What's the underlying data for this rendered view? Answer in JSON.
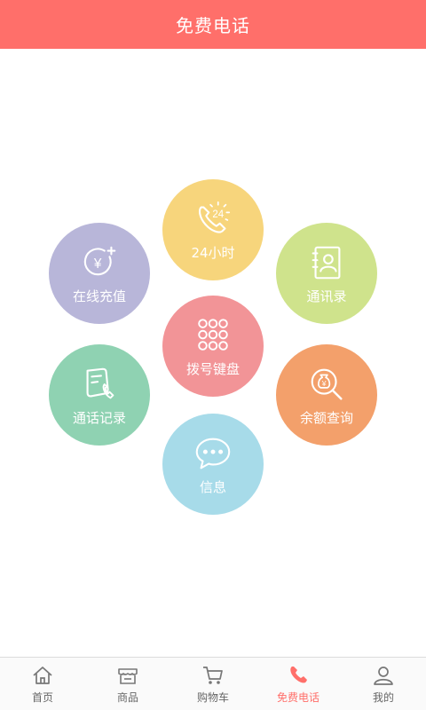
{
  "header": {
    "title": "免费电话"
  },
  "colors": {
    "header_bg": "#ff6f6a",
    "h24": "#f7d57c",
    "recharge": "#b8b6d9",
    "contacts": "#cfe38c",
    "dial": "#f29497",
    "record": "#8fd2b2",
    "balance": "#f3a06b",
    "message": "#a7dbe9",
    "tab_active": "#ff6f6a"
  },
  "features": {
    "h24": {
      "label": "24小时",
      "icon": "phone-24h-icon"
    },
    "recharge": {
      "label": "在线充值",
      "icon": "yuan-plus-icon"
    },
    "contacts": {
      "label": "通讯录",
      "icon": "address-book-icon"
    },
    "dial": {
      "label": "拨号键盘",
      "icon": "dialpad-icon"
    },
    "record": {
      "label": "通话记录",
      "icon": "call-log-icon"
    },
    "balance": {
      "label": "余额查询",
      "icon": "money-search-icon"
    },
    "message": {
      "label": "信息",
      "icon": "chat-bubble-icon"
    }
  },
  "icon_text": {
    "h24": "24",
    "yuan": "¥"
  },
  "tabs": [
    {
      "label": "首页",
      "icon": "home-icon"
    },
    {
      "label": "商品",
      "icon": "store-icon"
    },
    {
      "label": "购物车",
      "icon": "cart-icon"
    },
    {
      "label": "免费电话",
      "icon": "phone-icon",
      "active": true
    },
    {
      "label": "我的",
      "icon": "user-icon"
    }
  ]
}
